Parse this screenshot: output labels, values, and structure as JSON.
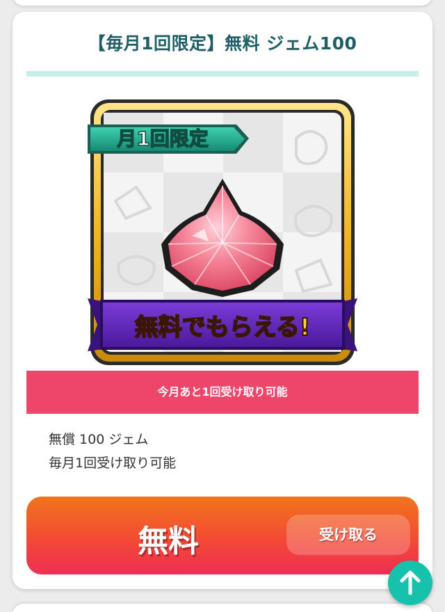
{
  "product": {
    "title": "【毎月1回限定】無料 ジェム100",
    "banner": {
      "ribbon_top": "月1回限定",
      "ribbon_bottom": "無料でもらえる!"
    },
    "status": "今月あと1回受け取り可能",
    "description": [
      "無償 100 ジェム",
      "毎月1回受け取り可能"
    ],
    "price_label": "無料",
    "receive_button_label": "受け取る"
  },
  "colors": {
    "title": "#1e5f66",
    "accent_bar": "#c5efeb",
    "status_strip": "#ee456a",
    "buy_gradient_start": "#f2741c",
    "buy_gradient_end": "#ef2e55",
    "scroll_button": "#17c2ad"
  },
  "icons": {
    "scroll_top": "arrow-up-icon",
    "gem": "pink-gem-icon"
  }
}
